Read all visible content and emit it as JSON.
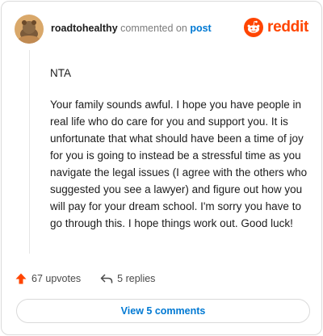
{
  "header": {
    "username": "roadtohealthy",
    "verb": "commented on",
    "post_link": "post",
    "logo_text": "reddit",
    "logo_icon": "reddit-snoo-icon",
    "avatar_icon": "user-avatar-icon"
  },
  "comment": {
    "paragraphs": [
      "NTA",
      "Your family sounds awful. I hope you have people in real life who do care for you and support you. It is unfortunate that what should have been a time of joy for you is going to instead be a stressful time as you navigate the legal issues (I agree with the others who suggested you see a lawyer) and figure out how you will pay for your dream school. I'm sorry you have to go through this. I hope things work out. Good luck!"
    ]
  },
  "actions": {
    "upvotes_label": "67 upvotes",
    "upvote_icon": "upvote-arrow-icon",
    "replies_label": "5 replies",
    "reply_icon": "reply-icon"
  },
  "footer": {
    "view_comments_label": "View 5 comments"
  },
  "colors": {
    "accent": "#ff4500",
    "link": "#0079d3",
    "muted": "#7c7c7c"
  }
}
